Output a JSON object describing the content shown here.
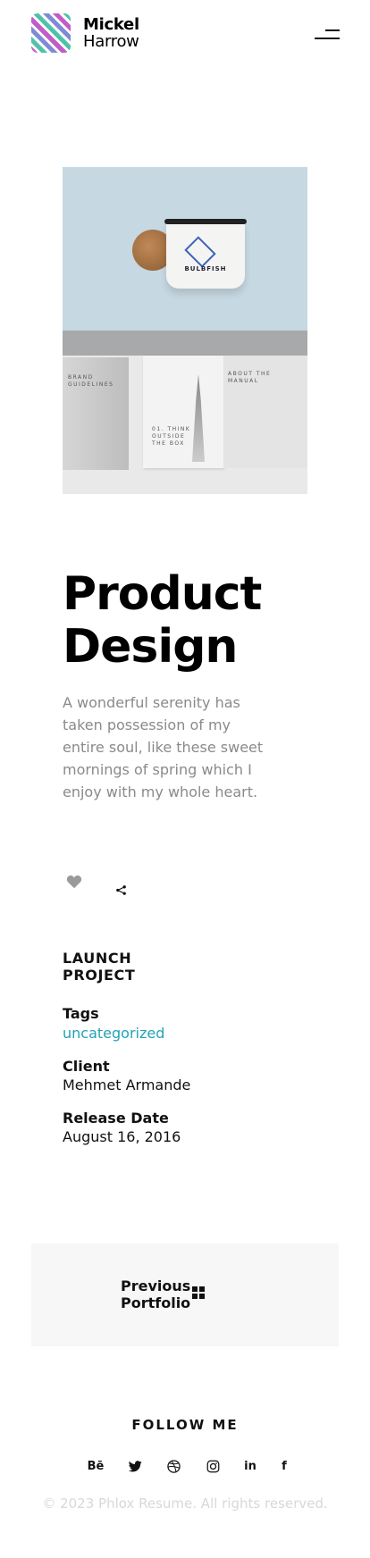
{
  "header": {
    "brand_name": "Mickel",
    "brand_sub": "Harrow",
    "menu_icon": "hamburger-menu-icon"
  },
  "hero": {
    "mug_text": "BULBFISH",
    "caption_left": "BRAND GUIDELINES",
    "caption_mid": "01. THINK OUTSIDE THE BOX",
    "caption_right": "ABOUT THE MANUAL"
  },
  "project": {
    "title": "Product Design",
    "description": "A wonderful serenity has taken possession of my entire soul, like these sweet mornings of spring which I enjoy with my whole heart.",
    "like_icon": "heart-icon",
    "share_icon": "share-icon",
    "launch_label": "LAUNCH PROJECT",
    "tags_label": "Tags",
    "tags_value": "uncategorized",
    "client_label": "Client",
    "client_value": "Mehmet Armande",
    "release_label": "Release Date",
    "release_value": "August 16, 2016"
  },
  "navigation": {
    "previous_label": "Previous Portfolio",
    "grid_icon": "grid-icon"
  },
  "footer": {
    "follow_label": "FOLLOW ME",
    "social": [
      {
        "name": "behance",
        "glyph": "Bē"
      },
      {
        "name": "twitter",
        "glyph": ""
      },
      {
        "name": "dribbble",
        "glyph": ""
      },
      {
        "name": "instagram",
        "glyph": ""
      },
      {
        "name": "linkedin",
        "glyph": "in"
      },
      {
        "name": "facebook",
        "glyph": "f"
      }
    ],
    "copyright": "© 2023 Phlox Resume. All rights reserved."
  },
  "colors": {
    "accent_link": "#22a3b6",
    "text_muted": "#8a8a8a",
    "panel_bg": "#f7f7f7"
  }
}
